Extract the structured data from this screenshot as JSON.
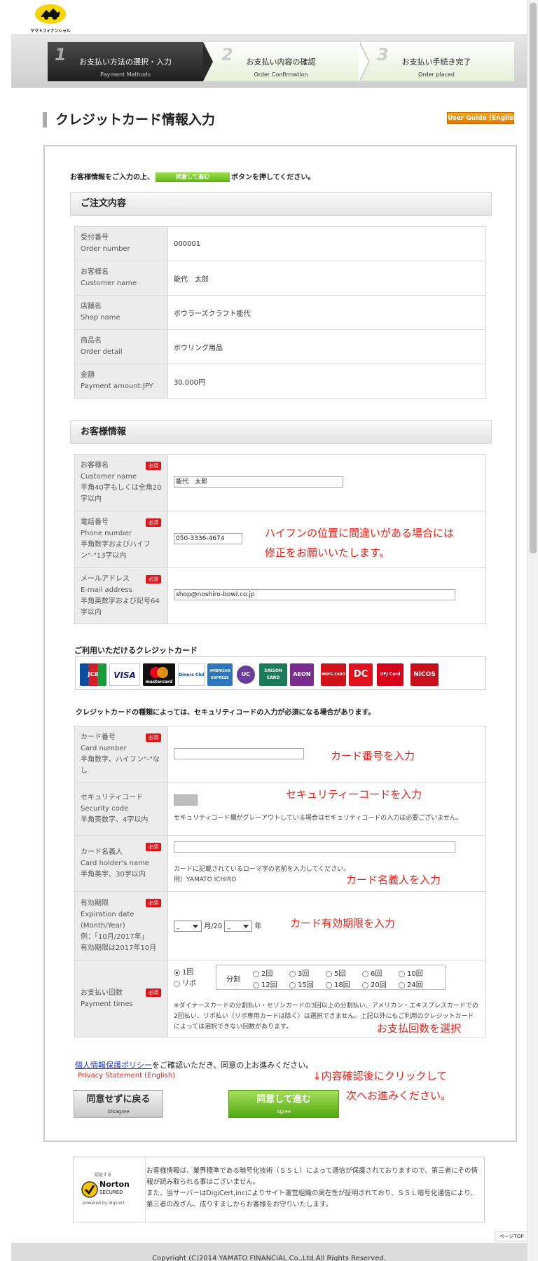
{
  "header": {
    "logo_text": "ヤマトフィナンシャル"
  },
  "steps": [
    {
      "num": "1",
      "label": "お支払い方法の選択・入力",
      "en": "Payment Methods"
    },
    {
      "num": "2",
      "label": "お支払い内容の確認",
      "en": "Order Confirmation"
    },
    {
      "num": "3",
      "label": "お支払い手続き完了",
      "en": "Order placed"
    }
  ],
  "page_title": "クレジットカード情報入力",
  "user_guide": "User Guide (English)",
  "instruction": {
    "before": "お客様情報をご入力の上、",
    "button": "同意して進む",
    "after": "ボタンを押してください。"
  },
  "order": {
    "heading": "ご注文内容",
    "rows": [
      {
        "jp": "受付番号",
        "en": "Order number",
        "value": "000001"
      },
      {
        "jp": "お客様名",
        "en": "Customer name",
        "value": "能代　太郎"
      },
      {
        "jp": "店舗名",
        "en": "Shop name",
        "value": "ボウラーズクラフト能代"
      },
      {
        "jp": "商品名",
        "en": "Order detail",
        "value": "ボウリング用品"
      },
      {
        "jp": "金額",
        "en": "Payment amount:JPY",
        "value": "30,000円"
      }
    ]
  },
  "customer": {
    "heading": "お客様情報",
    "required": "必須",
    "name": {
      "jp": "お客様名",
      "en": "Customer name",
      "hint": "半角40字もしくは全角20字以内",
      "value": "能代　太郎"
    },
    "phone": {
      "jp": "電話番号",
      "en": "Phone number",
      "hint": "半角数字およびハイフン\"-\"13字以内",
      "value": "050-3336-4674"
    },
    "email": {
      "jp": "メールアドレス",
      "en": "E-mail address",
      "hint": "半角英数字および記号64字以内",
      "value": "shop@noshiro-bowl.co.jp"
    },
    "phone_annotation_1": "ハイフンの位置に間違いがある場合には",
    "phone_annotation_2": "修正をお願いいたします。"
  },
  "cards": {
    "title": "ご利用いただけるクレジットカード",
    "brands": [
      "JCB",
      "VISA",
      "mastercard",
      "Diners Club",
      "AMERICAN EXPRESS",
      "UC",
      "SAISON CARD",
      "AEON",
      "MUFG CARD",
      "DC",
      "UFJ Card",
      "NICOS"
    ],
    "security_note": "クレジットカードの種類によっては、セキュリティコードの入力が必須になる場合があります。"
  },
  "card_form": {
    "number": {
      "jp": "カード番号",
      "en": "Card number",
      "hint": "半角数字、ハイフン\"-\"なし",
      "annotation": "カード番号を入力"
    },
    "security": {
      "jp": "セキュリティコード",
      "en": "Security code",
      "hint": "半角英数字、4字以内",
      "note": "セキュリティコード欄がグレーアウトしている場合はセキュリティコードの入力は必要ございません。",
      "annotation": "セキュリティーコードを入力"
    },
    "holder": {
      "jp": "カード名義人",
      "en": "Card holder's name",
      "hint": "半角英字、30字以内",
      "note": "カードに記載されているローマ字の名前を入力してください。",
      "example": "例）YAMATO ICHIRO",
      "annotation": "カード名義人を入力"
    },
    "expiry": {
      "jp": "有効期限",
      "en": "Expiration date (Month/Year)",
      "hint1": "例：「10月/2017年」",
      "hint2": "有効期限は2017年10月",
      "month_value": "_",
      "year_value": "_",
      "month_label": "月/20",
      "year_label": "年",
      "annotation": "カード有効期限を入力"
    },
    "payment": {
      "jp": "お支払い回数",
      "en": "Payment times",
      "once": "1回",
      "revolving": "リボ",
      "split": "分割",
      "options": [
        "2回",
        "3回",
        "5回",
        "6回",
        "10回",
        "12回",
        "15回",
        "18回",
        "20回",
        "24回"
      ],
      "note": "※ダイナースカードの分割払い・セゾンカードの3回以上の分割払い、アメリカン・エキスプレスカードでの2回払い、リボ払い（リボ専用カードは除く）は選択できません。上記以外にもご利用のクレジットカードによっては選択できない回数があります。",
      "annotation": "お支払回数を選択"
    }
  },
  "privacy": {
    "link": "個人情報保護ポリシー",
    "text": "をご確認いただき、同意の上お進みください。",
    "en": "Privacy Statement (English)"
  },
  "confirm_annotation_1": "↓内容確認後にクリックして",
  "confirm_annotation_2": "次へお進みください。",
  "buttons": {
    "back_jp": "同意せずに戻る",
    "back_en": "Disagree",
    "agree_jp": "同意して進む",
    "agree_en": "Agree"
  },
  "ssl": {
    "badge_top": "認証する",
    "badge_norton": "Norton",
    "badge_secured": "SECURED",
    "badge_powered": "powered by digicert",
    "text1": "お客様情報は、業界標準である暗号化技術（ＳＳＬ）によって通信が保護されておりますので、第三者にその情報が読み取られる事はございません。",
    "text2": "また、当サーバーはDigiCert,incによりサイト運営組織の実在性が証明されており、ＳＳＬ暗号化通信により、第三者の改ざん、成りすましからお客様をお守りいたします。"
  },
  "page_top": "ページTOP",
  "footer": "Copyright (C)2014 YAMATO FINANCIAL Co.,Ltd.All Rights Reserved."
}
